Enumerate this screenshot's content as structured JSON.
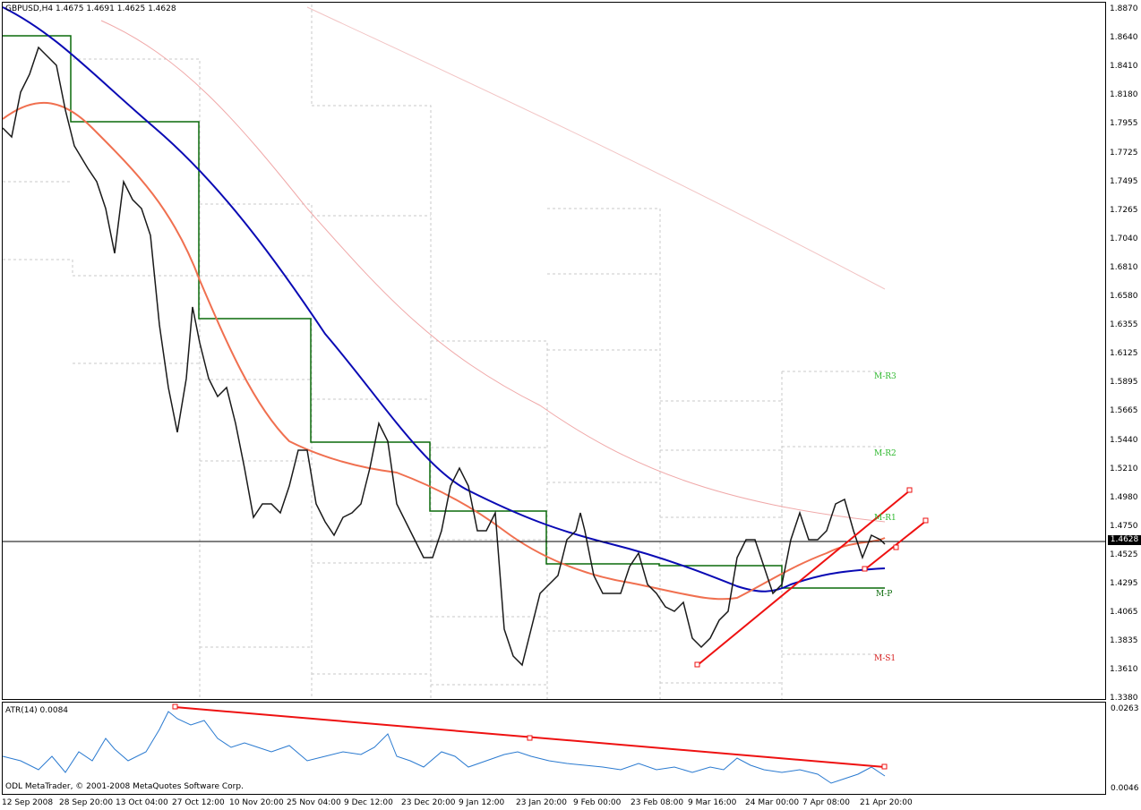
{
  "main_chart": {
    "symbol_info": "GBPUSD,H4  1.4675 1.4691 1.4625 1.4628",
    "current_price": "1.4628",
    "price_ticks": [
      "1.8870",
      "1.8640",
      "1.8410",
      "1.8180",
      "1.7955",
      "1.7725",
      "1.7495",
      "1.7265",
      "1.7040",
      "1.6810",
      "1.6580",
      "1.6355",
      "1.6125",
      "1.5895",
      "1.5665",
      "1.5440",
      "1.5210",
      "1.4980",
      "1.4750",
      "1.4525",
      "1.4295",
      "1.4065",
      "1.3835",
      "1.3610",
      "1.3380"
    ],
    "pivot_labels": {
      "r3": "M-R3",
      "r2": "M-R2",
      "r1": "M-R1",
      "p": "M-P",
      "s1": "M-S1"
    },
    "colors": {
      "pivot_green": "#2eb82e",
      "pivot_red": "#d62020",
      "ma_blue": "#0a0ab4",
      "ma_salmon": "#f07050",
      "trend_red": "#ee1111"
    }
  },
  "atr_chart": {
    "label": "ATR(14) 0.0084",
    "ticks": [
      "0.0263",
      "0.0046"
    ]
  },
  "footer": {
    "copyright": "ODL MetaTrader, © 2001-2008 MetaQuotes Software Corp."
  },
  "time_axis": [
    "12 Sep 2008",
    "28 Sep 20:00",
    "13 Oct 04:00",
    "27 Oct 12:00",
    "10 Nov 20:00",
    "25 Nov 04:00",
    "9 Dec 12:00",
    "23 Dec 20:00",
    "9 Jan 12:00",
    "23 Jan 20:00",
    "9 Feb 00:00",
    "23 Feb 08:00",
    "9 Mar 16:00",
    "24 Mar 00:00",
    "7 Apr 08:00",
    "21 Apr 20:00"
  ]
}
